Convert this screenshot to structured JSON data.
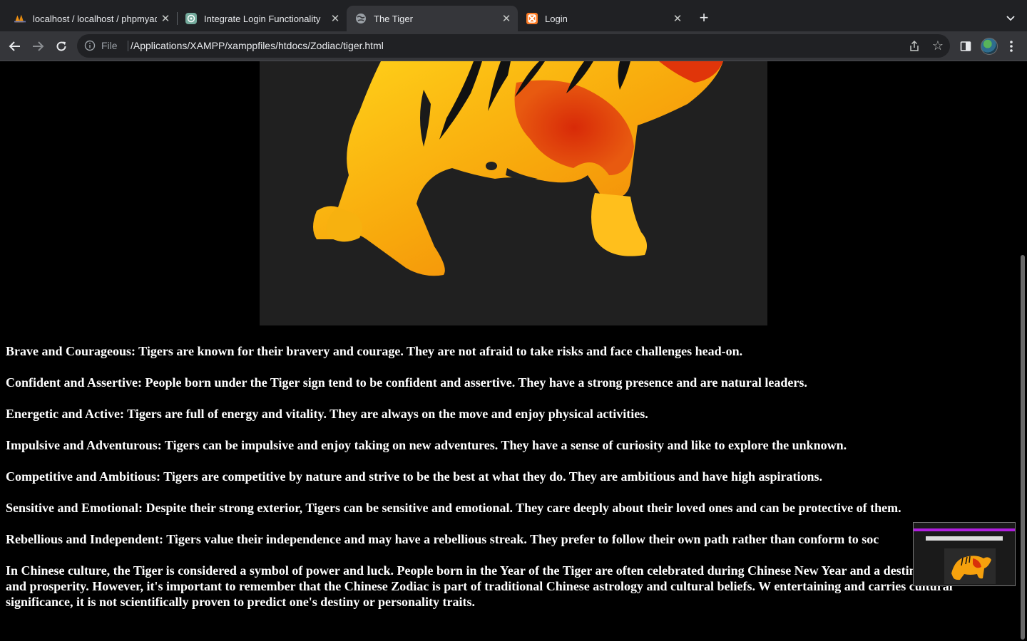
{
  "tabs": [
    {
      "title": "localhost / localhost / phpmyadmin",
      "icon": "phpmyadmin-icon"
    },
    {
      "title": "Integrate Login Functionality",
      "icon": "chatgpt-icon"
    },
    {
      "title": "The Tiger",
      "icon": "globe-icon",
      "active": true
    },
    {
      "title": "Login",
      "icon": "xampp-icon"
    }
  ],
  "address_bar": {
    "scheme": "File",
    "url": "/Applications/XAMPP/xamppfiles/htdocs/Zodiac/tiger.html"
  },
  "page": {
    "hero_image": "tiger-image",
    "traits": [
      "Brave and Courageous: Tigers are known for their bravery and courage. They are not afraid to take risks and face challenges head-on.",
      "Confident and Assertive: People born under the Tiger sign tend to be confident and assertive. They have a strong presence and are natural leaders.",
      "Energetic and Active: Tigers are full of energy and vitality. They are always on the move and enjoy physical activities.",
      "Impulsive and Adventurous: Tigers can be impulsive and enjoy taking on new adventures. They have a sense of curiosity and like to explore the unknown.",
      "Competitive and Ambitious: Tigers are competitive by nature and strive to be the best at what they do. They are ambitious and have high aspirations.",
      "Sensitive and Emotional: Despite their strong exterior, Tigers can be sensitive and emotional. They care deeply about their loved ones and can be protective of them.",
      "Rebellious and Independent: Tigers value their independence and may have a rebellious streak. They prefer to follow their own path rather than conform to soc"
    ],
    "closing": "In Chinese culture, the Tiger is considered a symbol of power and luck. People born in the Year of the Tiger are often celebrated during Chinese New Year and a destined for success and prosperity. However, it's important to remember that the Chinese Zodiac is part of traditional Chinese astrology and cultural beliefs. W entertaining and carries cultural significance, it is not scientifically proven to predict one's destiny or personality traits."
  },
  "colors": {
    "tab_strip": "#202124",
    "toolbar": "#35363a",
    "page_bg": "#000000",
    "hero_bg": "#202020",
    "text": "#ffffff"
  }
}
